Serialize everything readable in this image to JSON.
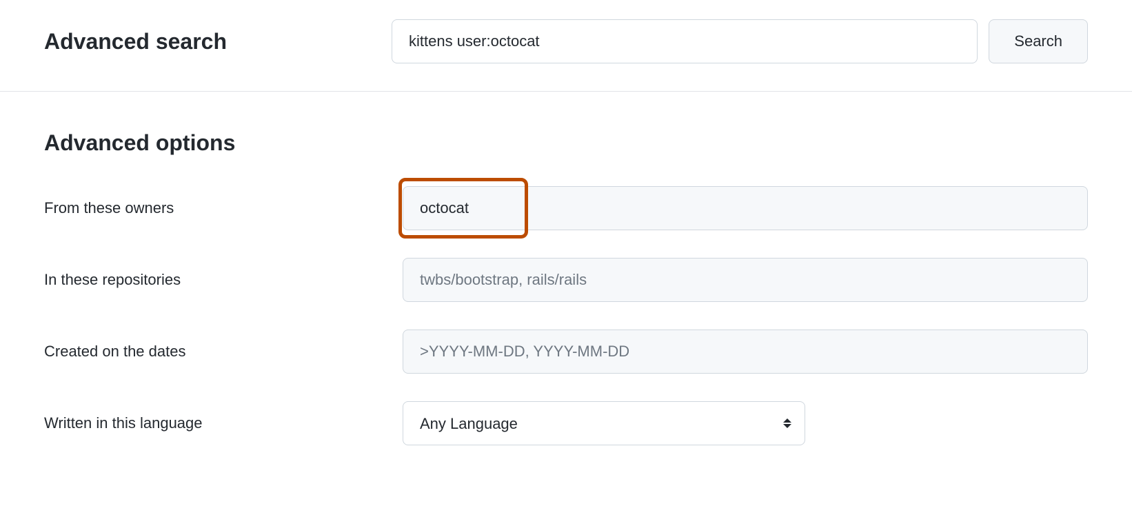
{
  "header": {
    "title": "Advanced search",
    "search_value": "kittens user:octocat",
    "search_button": "Search"
  },
  "section": {
    "title": "Advanced options",
    "fields": {
      "owners": {
        "label": "From these owners",
        "value": "octocat",
        "placeholder": ""
      },
      "repositories": {
        "label": "In these repositories",
        "value": "",
        "placeholder": "twbs/bootstrap, rails/rails"
      },
      "created": {
        "label": "Created on the dates",
        "value": "",
        "placeholder": ">YYYY-MM-DD, YYYY-MM-DD"
      },
      "language": {
        "label": "Written in this language",
        "selected": "Any Language"
      }
    }
  }
}
